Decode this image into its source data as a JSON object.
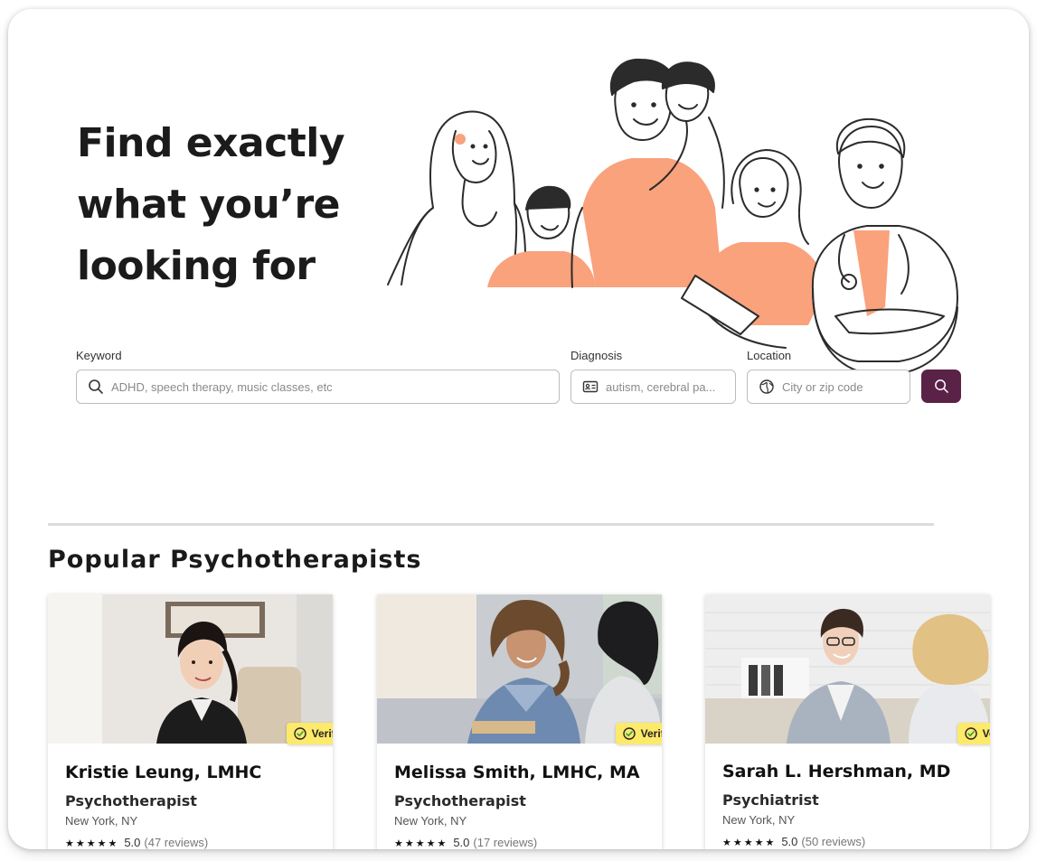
{
  "hero": {
    "title_line1": "Find exactly",
    "title_line2": "what you’re",
    "title_line3": "looking for"
  },
  "search": {
    "keyword_label": "Keyword",
    "keyword_placeholder": "ADHD, speech therapy, music classes, etc",
    "diagnosis_label": "Diagnosis",
    "diagnosis_placeholder": "autism, cerebral pa...",
    "location_label": "Location",
    "location_placeholder": "City or zip code",
    "button_icon": "search-icon",
    "button_color": "#5a2246"
  },
  "section": {
    "title": "Popular Psychotherapists"
  },
  "colors": {
    "accent_peach": "#f9a27c",
    "badge_yellow": "#fde96a",
    "verified_green": "#2e9e4f"
  },
  "cards": [
    {
      "badge": "Verified",
      "name": "Kristie Leung, LMHC",
      "role": "Psychotherapist",
      "location": "New York, NY",
      "stars": "★★★★★",
      "rating": "5.0",
      "reviews": "(47 reviews)"
    },
    {
      "badge": "Verified",
      "name": "Melissa Smith, LMHC, MA",
      "role": "Psychotherapist",
      "location": "New York, NY",
      "stars": "★★★★★",
      "rating": "5.0",
      "reviews": "(17 reviews)"
    },
    {
      "badge": "Verified",
      "name": "Sarah L. Hershman, MD",
      "role": "Psychiatrist",
      "location": "New York, NY",
      "stars": "★★★★★",
      "rating": "5.0",
      "reviews": "(50 reviews)"
    }
  ]
}
